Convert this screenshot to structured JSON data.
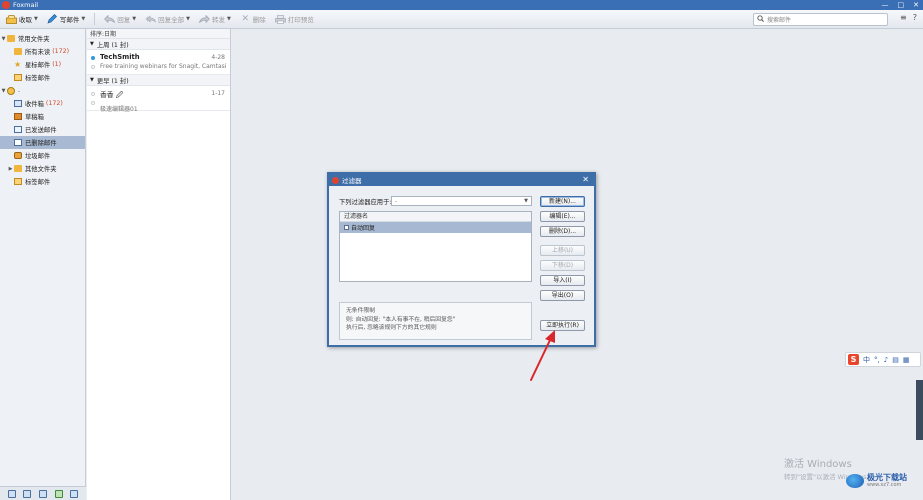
{
  "window": {
    "title": "Foxmail",
    "controls": [
      "—",
      "□",
      "✕"
    ]
  },
  "toolbar": {
    "receive": "收取",
    "compose": "写邮件",
    "reply": "回复",
    "reply_all": "回复全部",
    "forward": "转发",
    "delete": "删除",
    "print_preview": "打印预览",
    "search_placeholder": "搜索邮件",
    "right_icons": [
      "≡",
      "?"
    ]
  },
  "sidebar": {
    "common_folders": "常用文件夹",
    "items_common": [
      {
        "label": "所有未读",
        "count": "(172)",
        "icon": "folder-icon"
      },
      {
        "label": "星标邮件",
        "count": "(1)",
        "icon": "star-icon"
      },
      {
        "label": "标签邮件",
        "count": "",
        "icon": "tag-folder-icon"
      }
    ],
    "account": ".",
    "items_account": [
      {
        "label": "收件箱",
        "count": "(172)",
        "icon": "inbox-icon",
        "selected": false
      },
      {
        "label": "草稿箱",
        "count": "",
        "icon": "drafts-icon",
        "selected": false
      },
      {
        "label": "已发送邮件",
        "count": "",
        "icon": "sent-icon",
        "selected": false
      },
      {
        "label": "已删除邮件",
        "count": "",
        "icon": "trash-icon",
        "selected": true
      },
      {
        "label": "垃圾邮件",
        "count": "",
        "icon": "junk-icon",
        "selected": false
      },
      {
        "label": "其他文件夹",
        "count": "",
        "icon": "folder-icon",
        "selected": false
      },
      {
        "label": "标签邮件",
        "count": "",
        "icon": "tag-folder-icon",
        "selected": false
      }
    ]
  },
  "message_list": {
    "sort_label": "排序:日期",
    "groups": [
      {
        "header": "上周 (1 封)",
        "messages": [
          {
            "from": "TechSmith",
            "date": "4-28",
            "subject": "Free training webinars for Snagit, Camtasia...",
            "unread": true
          }
        ]
      },
      {
        "header": "更早 (1 封)",
        "messages": [
          {
            "from": "香香 🖉",
            "date": "1-17",
            "subject": "极速编辑器01",
            "unread": false
          }
        ]
      }
    ]
  },
  "dialog": {
    "title": "过滤器",
    "apply_label": "下列过滤器应用于:",
    "apply_value": ".",
    "list_header": "过滤器名",
    "filters": [
      {
        "name": "自动回复",
        "checked": true
      }
    ],
    "desc_lines": [
      "无条件限制",
      "则: 自动回复: \"本人有事不在, 稍后回复您\"",
      "执行后, 忽略该规则下方的其它规则"
    ],
    "buttons": {
      "new": "新建(N)...",
      "edit": "编辑(E)...",
      "delete": "删除(D)...",
      "up": "上移(U)",
      "down": "下移(D)",
      "import": "导入(I)",
      "export": "导出(O)",
      "run_now": "立即执行(R)"
    }
  },
  "ime": {
    "logo": "S",
    "items": [
      "中",
      "°,",
      "♪",
      "▤",
      "▦"
    ]
  },
  "watermark": {
    "activate_title": "激活 Windows",
    "activate_sub": "转到\"设置\"以激活 Windows。",
    "brand_name": "极光下载站",
    "brand_url": "www.xz7.com"
  },
  "colors": {
    "titlebar": "#3b6fb5",
    "selected_row": "#a7b9d3",
    "unread_count": "#d04a2a",
    "annotation_arrow": "#d9262a"
  }
}
